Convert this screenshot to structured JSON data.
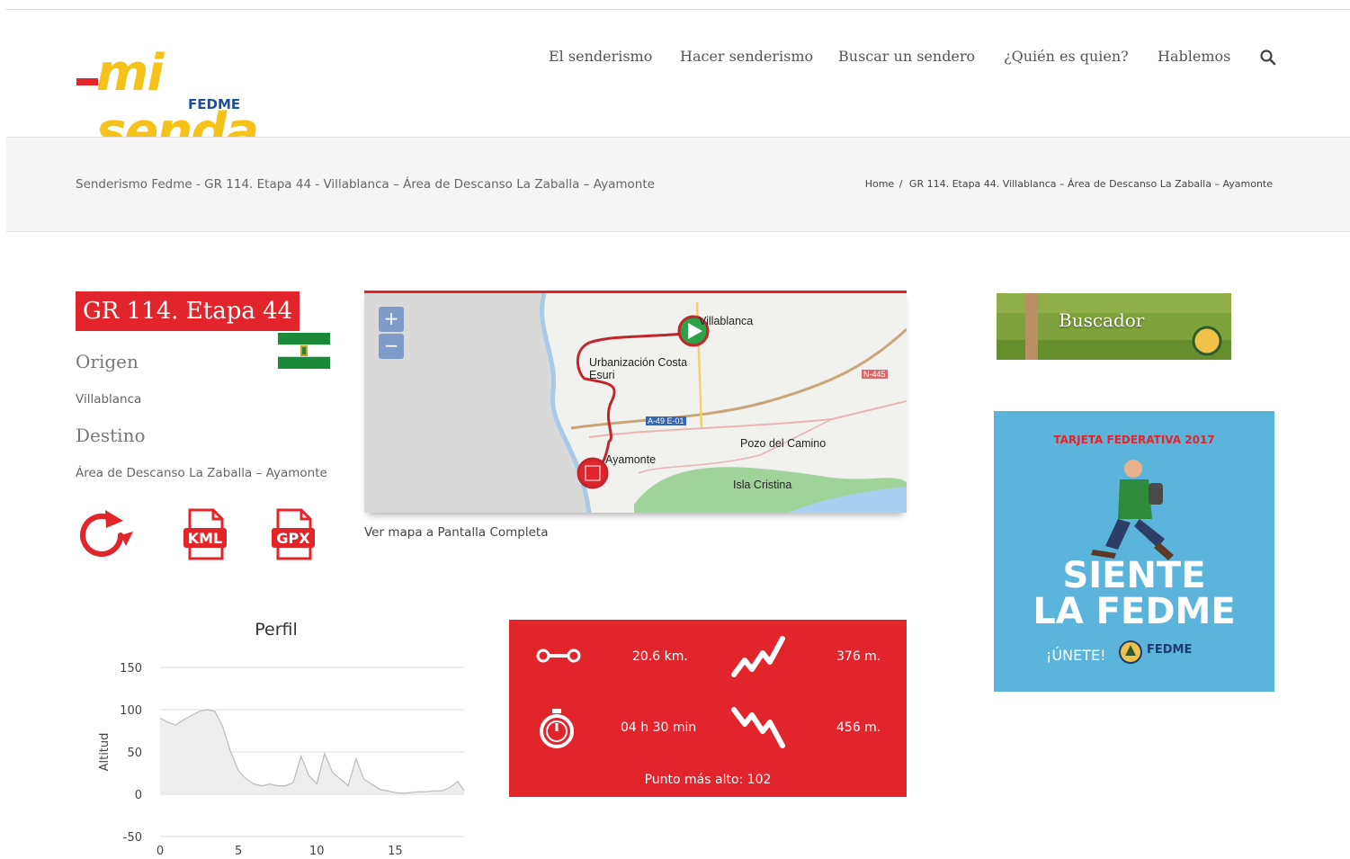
{
  "site": {
    "logo_text": "mi senda",
    "logo_subtext": "FEDME"
  },
  "nav": {
    "items": [
      {
        "label": "El senderismo"
      },
      {
        "label": "Hacer senderismo"
      },
      {
        "label": "Buscar un sendero"
      },
      {
        "label": "¿Quién es quien?"
      },
      {
        "label": "Hablemos"
      }
    ],
    "search_icon": "search-icon"
  },
  "breadcrumb": {
    "page_title": "Senderismo Fedme - GR 114. Etapa 44 - Villablanca – Área de Descanso La Zaballa – Ayamonte",
    "home": "Home",
    "separator": "/",
    "current": "GR 114. Etapa 44. Villablanca – Área de Descanso La Zaballa – Ayamonte"
  },
  "stage": {
    "title": "GR 114. Etapa 44",
    "origin_label": "Origen",
    "origin_value": "Villablanca",
    "destination_label": "Destino",
    "destination_value": "Área de Descanso La Zaballa – Ayamonte",
    "downloads": [
      {
        "icon": "circular-route-icon"
      },
      {
        "icon": "kml-file-icon",
        "label": "KML"
      },
      {
        "icon": "gpx-file-icon",
        "label": "GPX"
      }
    ]
  },
  "map": {
    "zoom_in": "+",
    "zoom_out": "−",
    "labels": {
      "villablanca": "Villablanca",
      "urbanizacion": "Urbanización Costa",
      "urbanizacion2": "Esuri",
      "ayamonte": "Ayamonte",
      "pozo": "Pozo del Camino",
      "isla": "Isla Cristina",
      "road_a49": "A-49 E-01",
      "road_n445": "N-445"
    },
    "fullscreen_link": "Ver mapa a Pantalla Completa"
  },
  "chart_data": {
    "type": "area",
    "title": "Perfil",
    "xlabel": "",
    "ylabel": "Altitud",
    "xlim": [
      0,
      19.4
    ],
    "ylim": [
      -50,
      150
    ],
    "x_ticks": [
      "0",
      "5",
      "10",
      "15"
    ],
    "y_ticks": [
      "150",
      "100",
      "50",
      "0",
      "-50"
    ],
    "grid": true,
    "x": [
      0,
      0.5,
      1,
      1.5,
      2,
      2.5,
      3,
      3.5,
      4,
      4.5,
      5,
      5.5,
      6,
      6.5,
      7,
      7.5,
      8,
      8.5,
      9,
      9.5,
      10,
      10.5,
      11,
      11.5,
      12,
      12.5,
      13,
      13.5,
      14,
      14.5,
      15,
      15.5,
      16,
      16.5,
      17,
      17.5,
      18,
      18.5,
      19,
      19.4
    ],
    "values": [
      90,
      85,
      82,
      88,
      93,
      98,
      100,
      98,
      80,
      50,
      28,
      18,
      12,
      10,
      12,
      10,
      10,
      14,
      45,
      22,
      12,
      48,
      26,
      18,
      10,
      42,
      18,
      12,
      6,
      4,
      2,
      1,
      2,
      3,
      3,
      4,
      4,
      8,
      15,
      4
    ]
  },
  "stats": {
    "distance": "20.6 km.",
    "ascent": "376 m.",
    "time": "04 h 30 min",
    "descent": "456 m.",
    "highest": "Punto más alto: 102"
  },
  "sidebar": {
    "buscador_label": "Buscador",
    "promo": {
      "subtitle": "TARJETA FEDERATIVA 2017",
      "line1": "SIENTE",
      "line2": "LA FEDME",
      "join": "¡ÚNETE!",
      "brand": "FEDME"
    }
  },
  "colors": {
    "accent": "#e1252b",
    "logo_yellow": "#f5c21a",
    "logo_blue": "#1f4e9c",
    "promo_blue": "#5ab4dc"
  }
}
